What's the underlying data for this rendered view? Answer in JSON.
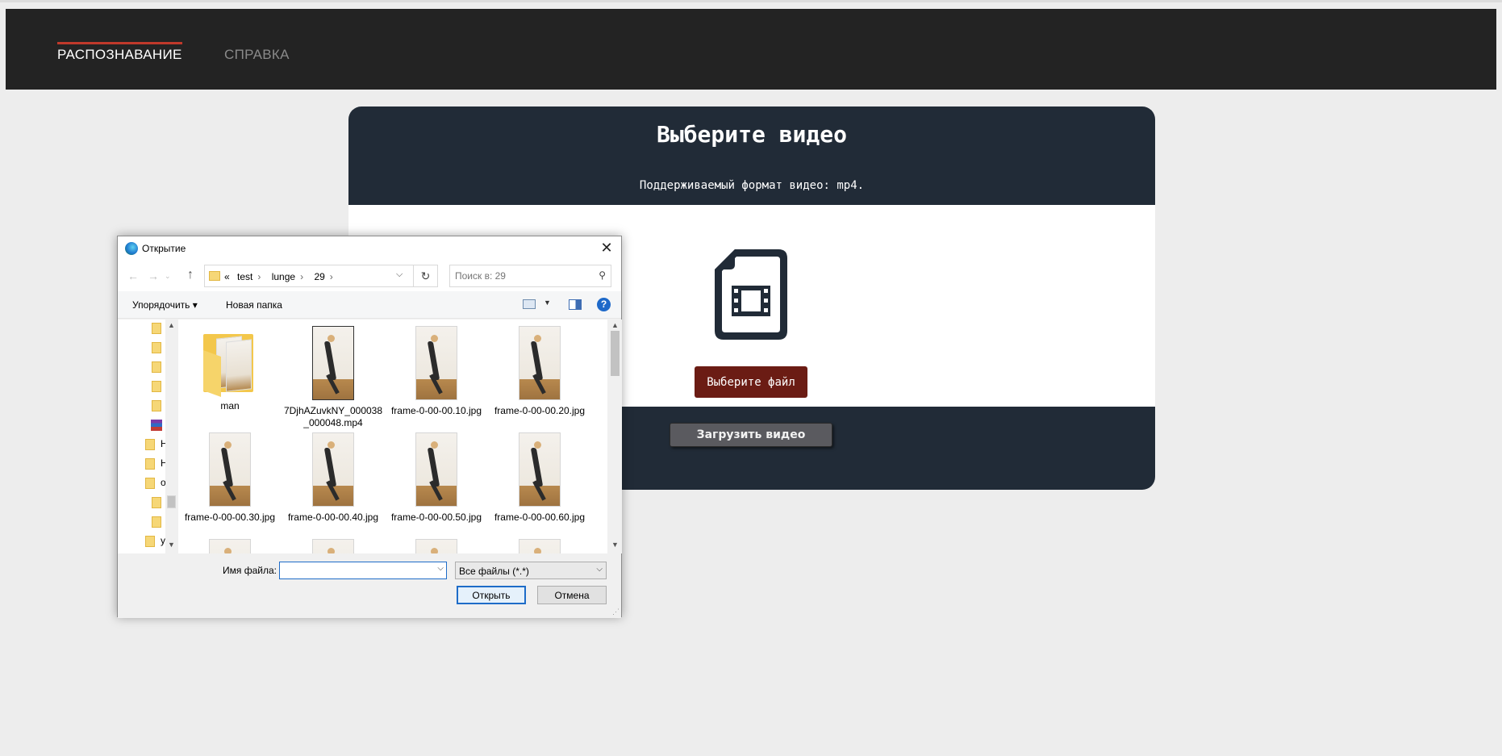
{
  "nav": {
    "active_tab": "РАСПОЗНАВАНИЕ",
    "help_tab": "СПРАВКА"
  },
  "panel": {
    "title": "Выберите видео",
    "subtitle": "Поддерживаемый формат видео: mp4.",
    "choose_button": "Выберите файл",
    "upload_button": "Загрузить видео",
    "icon": "video-file-icon"
  },
  "dialog": {
    "title": "Открытие",
    "breadcrumb": [
      "«",
      "test",
      "lunge",
      "29"
    ],
    "search_placeholder": "Поиск в: 29",
    "organize_label": "Упорядочить ▾",
    "new_folder_label": "Новая папка",
    "help_glyph": "?",
    "tree_items": [
      "",
      "",
      "",
      "",
      "",
      "",
      "H",
      "H",
      "o",
      "",
      "",
      "y"
    ],
    "files": [
      {
        "name": "man",
        "kind": "folder"
      },
      {
        "name": "7DjhAZuvkNY_000038_000048.mp4",
        "kind": "video"
      },
      {
        "name": "frame-0-00-00.10.jpg",
        "kind": "image"
      },
      {
        "name": "frame-0-00-00.20.jpg",
        "kind": "image"
      },
      {
        "name": "frame-0-00-00.30.jpg",
        "kind": "image"
      },
      {
        "name": "frame-0-00-00.40.jpg",
        "kind": "image"
      },
      {
        "name": "frame-0-00-00.50.jpg",
        "kind": "image"
      },
      {
        "name": "frame-0-00-00.60.jpg",
        "kind": "image"
      }
    ],
    "filename_label": "Имя файла:",
    "filename_value": "",
    "filter_value": "Все файлы (*.*)",
    "open_button": "Открыть",
    "cancel_button": "Отмена"
  },
  "colors": {
    "navbar": "#232323",
    "nav_accent": "#c0392b",
    "panel": "#212b37",
    "choose_button": "#6b1c14",
    "upload_button": "#5a5a5f"
  }
}
